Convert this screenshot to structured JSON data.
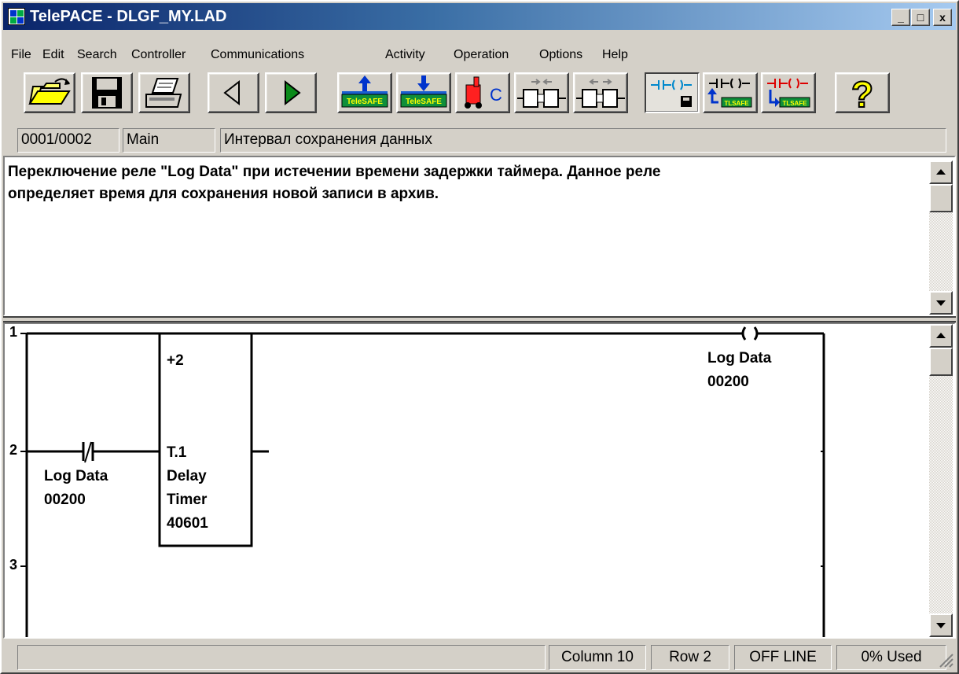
{
  "window": {
    "title": "TelePACE - DLGF_MY.LAD",
    "minimize": "_",
    "maximize": "□",
    "close": "x"
  },
  "menu": [
    {
      "label": "File"
    },
    {
      "label": "Edit"
    },
    {
      "label": "Search"
    },
    {
      "label": "Controller"
    },
    {
      "label": "Communications"
    },
    {
      "label": "Activity"
    },
    {
      "label": "Operation"
    },
    {
      "label": "Options"
    },
    {
      "label": "Help"
    }
  ],
  "toolbar": {
    "icons": [
      "open-folder-icon",
      "save-disk-icon",
      "print-icon",
      "previous-network-icon",
      "next-network-icon",
      "write-to-controller-icon",
      "read-from-controller-icon",
      "initialize-controller-icon",
      "disconnect-icon",
      "connect-icon",
      "edit-mode-icon",
      "write-program-icon",
      "read-program-icon",
      "help-icon"
    ],
    "telesafe_label": "TeleSAFE",
    "tlsafe_label": "TLSAFE"
  },
  "network_status": {
    "position": "0001/0002",
    "section": "Main",
    "title": "Интервал сохранения данных"
  },
  "comment": {
    "line1": "Переключение реле \"Log Data\" при истечении времени задержки таймера. Данное реле",
    "line2": "определяет время для сохранения новой записи в архив."
  },
  "ladder": {
    "rungs": [
      "1",
      "2",
      "3"
    ],
    "timer_preset": "+2",
    "timer_register": "T.1",
    "timer_label_1": "Delay",
    "timer_label_2": "Timer",
    "timer_address": "40601",
    "contact_name": "Log Data",
    "contact_address": "00200",
    "coil_name": "Log Data",
    "coil_address": "00200"
  },
  "statusbar": {
    "column": "Column 10",
    "row": "Row 2",
    "mode": "OFF LINE",
    "used": "0% Used"
  },
  "colors": {
    "title_start": "#0a246a",
    "title_end": "#a6caf0",
    "telesafe_green": "#0f8f3a",
    "arrow_blue": "#0033cc",
    "help_yellow": "#ffff00"
  }
}
